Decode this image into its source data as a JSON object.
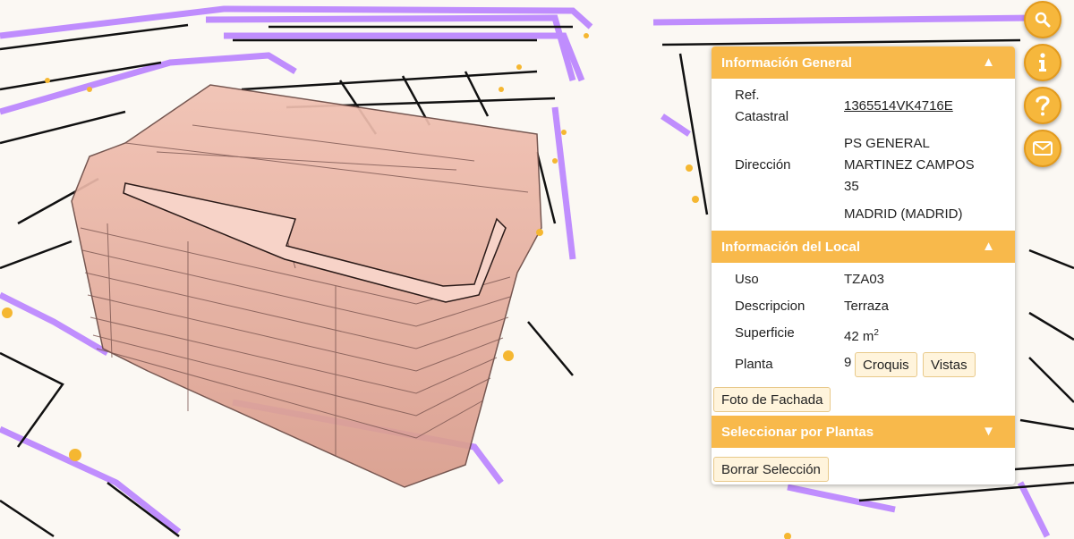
{
  "toolbar": {
    "buttons": [
      {
        "name": "search-button",
        "icon": "search-icon"
      },
      {
        "name": "info-button",
        "icon": "info-icon"
      },
      {
        "name": "help-button",
        "icon": "help-icon"
      },
      {
        "name": "mail-button",
        "icon": "mail-icon"
      }
    ],
    "accent": "#f6b73c"
  },
  "panel": {
    "general": {
      "title": "Información General",
      "toggle": "▲",
      "ref_label_1": "Ref.",
      "ref_label_2": "Catastral",
      "ref_value": "1365514VK4716E",
      "address_label": "Dirección",
      "address_line1": "PS GENERAL",
      "address_line2": "MARTINEZ CAMPOS",
      "address_line3": "35",
      "address_city": "MADRID (MADRID)"
    },
    "local": {
      "title": "Información del Local",
      "toggle": "▲",
      "uso_label": "Uso",
      "uso_value": "TZA03",
      "descripcion_label": "Descripcion",
      "descripcion_value": "Terraza",
      "superficie_label": "Superficie",
      "superficie_value": "42 m",
      "superficie_unit_sup": "2",
      "planta_label": "Planta",
      "planta_value": "9",
      "croquis_button": "Croquis",
      "vistas_button": "Vistas",
      "fachada_button": "Foto de Fachada"
    },
    "plantas": {
      "title": "Seleccionar por Plantas",
      "toggle": "▼",
      "borrar_button": "Borrar Selección"
    },
    "header_color": "#f8b94b"
  },
  "map": {
    "building_color": "#e8a594",
    "road_outline_color": "#b57bff",
    "marker_color": "#f5b731"
  }
}
